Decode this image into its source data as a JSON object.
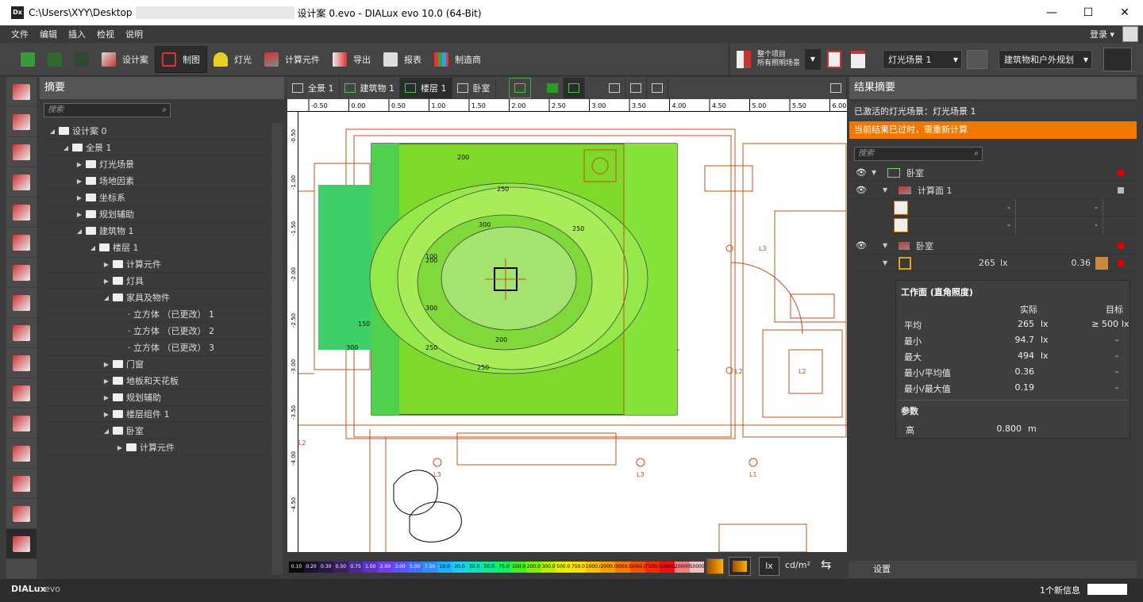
{
  "window": {
    "app_icon": "Dx",
    "title_prefix": "C:\\Users\\XYY\\Desktop",
    "title_suffix": "设计案 0.evo - DIALux evo 10.0  (64-Bit)",
    "minimize": "—",
    "maximize": "☐",
    "close": "✕"
  },
  "menu": {
    "items": [
      "文件",
      "编辑",
      "插入",
      "检视",
      "说明"
    ],
    "login": "登录 ▾"
  },
  "toolbar": {
    "design": "设计案",
    "draw": "制图",
    "light": "灯光",
    "calc": "计算元件",
    "export": "导出",
    "report": "报表",
    "manufacturer": "制造商",
    "scene_info_line1": "整个项目",
    "scene_info_line2": "所有照明场景",
    "scene_select": "灯光场景 1",
    "planning_select": "建筑物和户外规划"
  },
  "left_panel": {
    "title": "摘要",
    "search_placeholder": "搜索",
    "tree": [
      {
        "label": "设计案 0",
        "level": 0,
        "expanded": true
      },
      {
        "label": "全景 1",
        "level": 1,
        "expanded": true
      },
      {
        "label": "灯光场景",
        "level": 2,
        "expanded": false
      },
      {
        "label": "场地因素",
        "level": 2,
        "expanded": false
      },
      {
        "label": "坐标系",
        "level": 2,
        "expanded": false
      },
      {
        "label": "规划辅助",
        "level": 2,
        "expanded": false
      },
      {
        "label": "建筑物 1",
        "level": 2,
        "expanded": true
      },
      {
        "label": "楼层 1",
        "level": 3,
        "expanded": true
      },
      {
        "label": "计算元件",
        "level": 4,
        "expanded": false
      },
      {
        "label": "灯具",
        "level": 4,
        "expanded": false
      },
      {
        "label": "家具及物件",
        "level": 4,
        "expanded": true
      },
      {
        "label": "· 立方体 （已更改） 1",
        "level": 5,
        "leaf": true
      },
      {
        "label": "· 立方体 （已更改） 2",
        "level": 5,
        "leaf": true
      },
      {
        "label": "· 立方体 （已更改） 3",
        "level": 5,
        "leaf": true
      },
      {
        "label": "门窗",
        "level": 4,
        "expanded": false
      },
      {
        "label": "地板和天花板",
        "level": 4,
        "expanded": false
      },
      {
        "label": "规划辅助",
        "level": 4,
        "expanded": false
      },
      {
        "label": "楼层组件 1",
        "level": 4,
        "expanded": false
      },
      {
        "label": "卧室",
        "level": 4,
        "expanded": true
      },
      {
        "label": "计算元件",
        "level": 5,
        "expanded": false
      }
    ]
  },
  "canvas": {
    "tabs": [
      "全景 1",
      "建筑物 1",
      "楼层 1",
      "卧室"
    ],
    "active_tab": "楼层 1",
    "ruler_top": [
      "-0.50",
      "0.00",
      "0.50",
      "1.00",
      "1.50",
      "2.00",
      "2.50",
      "3.00",
      "3.50",
      "4.00",
      "4.50",
      "5.00",
      "5.50",
      "6.00"
    ],
    "ruler_left": [
      "-0.50",
      "-1.00",
      "-1.50",
      "-2.00",
      "-2.50",
      "-3.00",
      "-3.50",
      "-4.00",
      "-4.50"
    ],
    "contours": [
      "200",
      "250",
      "300",
      "250",
      "200",
      "250",
      "300",
      "150",
      "100",
      "300",
      "200",
      "250"
    ],
    "luminaire_labels": [
      "L3",
      "L2",
      "L2",
      "L3",
      "L3",
      "L1",
      "L2"
    ],
    "scale_values": [
      "0.10",
      "0.20",
      "0.30",
      "0.50",
      "0.75",
      "1.00",
      "2.00",
      "3.00",
      "5.00",
      "7.50",
      "10.0",
      "20.0",
      "30.0",
      "50.0",
      "75.0",
      "100.0",
      "200.0",
      "300.0",
      "500.0",
      "750.0",
      "1000.0",
      "2000.0",
      "3000.0",
      "5000.0",
      "7500.0",
      "10000.0",
      "20000.0",
      "50000.0"
    ],
    "scale_colors": [
      "#0a0a0a",
      "#1a1030",
      "#281848",
      "#381f66",
      "#4b2896",
      "#5c33c8",
      "#6e3df0",
      "#5a52ff",
      "#4070ff",
      "#2f8cff",
      "#1fb0ff",
      "#16d2f0",
      "#10e0c0",
      "#10e890",
      "#10f060",
      "#40f020",
      "#80f010",
      "#b8f000",
      "#e8f000",
      "#ffe000",
      "#ffc000",
      "#ffa000",
      "#ff7800",
      "#ff5000",
      "#ff2800",
      "#f01010",
      "#f08080",
      "#f0c0c0"
    ],
    "unit_lx": "lx",
    "unit_cd": "cd/m²",
    "legend_swap": "⇆"
  },
  "right_panel": {
    "title": "结果摘要",
    "active_scene": "已激活的灯光场景：灯光场景 1",
    "warning": "当前结果已过时，需重新计算",
    "search_placeholder": "搜索",
    "items": [
      {
        "label": "卧室",
        "level": 0
      },
      {
        "label": "计算面 1",
        "level": 1
      },
      {
        "label": "卧室",
        "level": 0
      }
    ],
    "calc_rows": [
      [
        "-",
        "-"
      ],
      [
        "-",
        "-"
      ]
    ],
    "room_value": "265",
    "room_unit": "lx",
    "room_ratio": "0.36",
    "workplane": {
      "title": "工作面 (直角照度)",
      "col_actual": "实际",
      "col_target": "目标",
      "rows": [
        {
          "label": "平均",
          "actual": "265",
          "unit": "lx",
          "target": "≥  500",
          "tunit": "lx"
        },
        {
          "label": "最小",
          "actual": "94.7",
          "unit": "lx",
          "target": "-",
          "tunit": ""
        },
        {
          "label": "最大",
          "actual": "494",
          "unit": "lx",
          "target": "-",
          "tunit": ""
        },
        {
          "label": "最小/平均值",
          "actual": "0.36",
          "unit": "",
          "target": "-",
          "tunit": ""
        },
        {
          "label": "最小/最大值",
          "actual": "0.19",
          "unit": "",
          "target": "-",
          "tunit": ""
        }
      ],
      "params_title": "参数",
      "height_label": "高",
      "height_value": "0.800",
      "height_unit": "m"
    },
    "settings": "设置"
  },
  "status": {
    "brand_a": "DIALux",
    "brand_b": "evo",
    "message": "1个新信息"
  },
  "colors": {
    "accent_warning": "#f07800",
    "active_red": "#d00000",
    "plan_line": "#c0501a"
  }
}
